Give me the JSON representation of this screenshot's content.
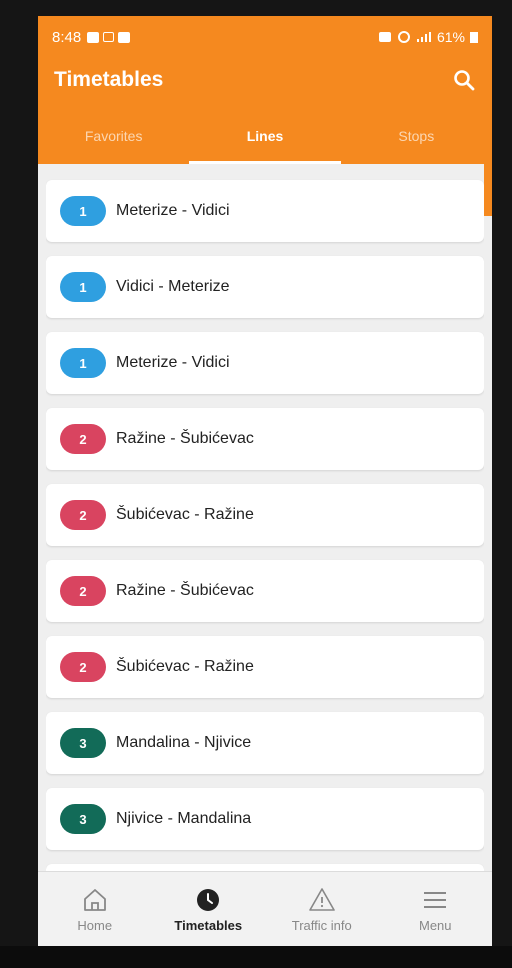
{
  "status_bar": {
    "time": "8:48",
    "battery": "61%"
  },
  "header": {
    "title": "Timetables",
    "search_icon": "search-icon"
  },
  "tabs": [
    {
      "label": "Favorites",
      "active": false
    },
    {
      "label": "Lines",
      "active": true
    },
    {
      "label": "Stops",
      "active": false
    }
  ],
  "colors": {
    "brand": "#f5891f",
    "line1": "#2f9fe0",
    "line2": "#d94460",
    "line3": "#126b58",
    "line4": "#b88a2a"
  },
  "lines": [
    {
      "number": "1",
      "route": "Meterize -  Vidici",
      "color": "#2f9fe0"
    },
    {
      "number": "1",
      "route": "Vidici - Meterize",
      "color": "#2f9fe0"
    },
    {
      "number": "1",
      "route": "Meterize - Vidici",
      "color": "#2f9fe0"
    },
    {
      "number": "2",
      "route": "Ražine -  Šubićevac",
      "color": "#d94460"
    },
    {
      "number": "2",
      "route": "Šubićevac - Ražine",
      "color": "#d94460"
    },
    {
      "number": "2",
      "route": "Ražine - Šubićevac",
      "color": "#d94460"
    },
    {
      "number": "2",
      "route": "Šubićevac -  Ražine",
      "color": "#d94460"
    },
    {
      "number": "3",
      "route": "Mandalina - Njivice",
      "color": "#126b58"
    },
    {
      "number": "3",
      "route": "Njivice - Mandalina",
      "color": "#126b58"
    },
    {
      "number": "",
      "route": "",
      "color": "#b88a2a"
    }
  ],
  "bottom_nav": [
    {
      "label": "Home",
      "icon": "home-icon",
      "active": false
    },
    {
      "label": "Timetables",
      "icon": "clock-icon",
      "active": true
    },
    {
      "label": "Traffic info",
      "icon": "warning-icon",
      "active": false
    },
    {
      "label": "Menu",
      "icon": "menu-icon",
      "active": false
    }
  ]
}
